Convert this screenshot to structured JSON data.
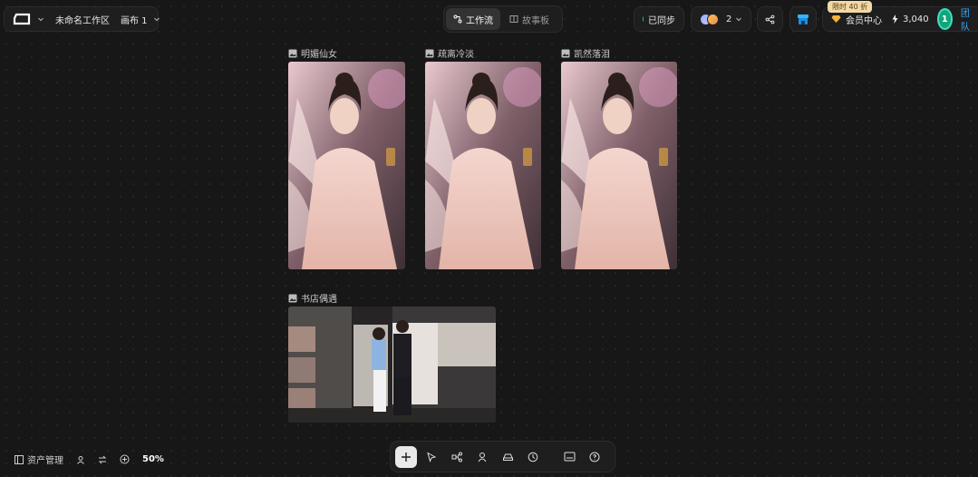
{
  "header": {
    "workspace_name": "未命名工作区",
    "canvas_name": "画布 1",
    "tabs": [
      {
        "label": "工作流",
        "icon": "workflow-icon",
        "active": true
      },
      {
        "label": "故事板",
        "icon": "storyboard-icon",
        "active": false
      }
    ],
    "sync_status": "已同步",
    "collaborator_count": "2",
    "promo_badge": "限时 40 折",
    "member_center": "会员中心",
    "credits": "3,040",
    "user_initial": "1",
    "team_label": "团队"
  },
  "canvas": {
    "cards": [
      {
        "title": "明媚仙女",
        "icon": "image-icon"
      },
      {
        "title": "疏离冷淡",
        "icon": "image-icon"
      },
      {
        "title": "凯然落泪",
        "icon": "image-icon"
      },
      {
        "title": "书店偶遇",
        "icon": "image-icon"
      }
    ]
  },
  "bottom_left": {
    "asset_manager": "资产管理",
    "zoom": "50%"
  },
  "toolbar": {
    "tools": [
      "add-icon",
      "select-pointer-icon",
      "workflow-node-icon",
      "character-icon",
      "vehicle-icon",
      "history-icon",
      "subtitle-icon",
      "help-icon"
    ]
  },
  "colors": {
    "accent_team": "#35a8ff",
    "sync_green": "#22c55e",
    "avatar_teal": "#13a37a",
    "promo_bg": "#f2d9a6"
  }
}
